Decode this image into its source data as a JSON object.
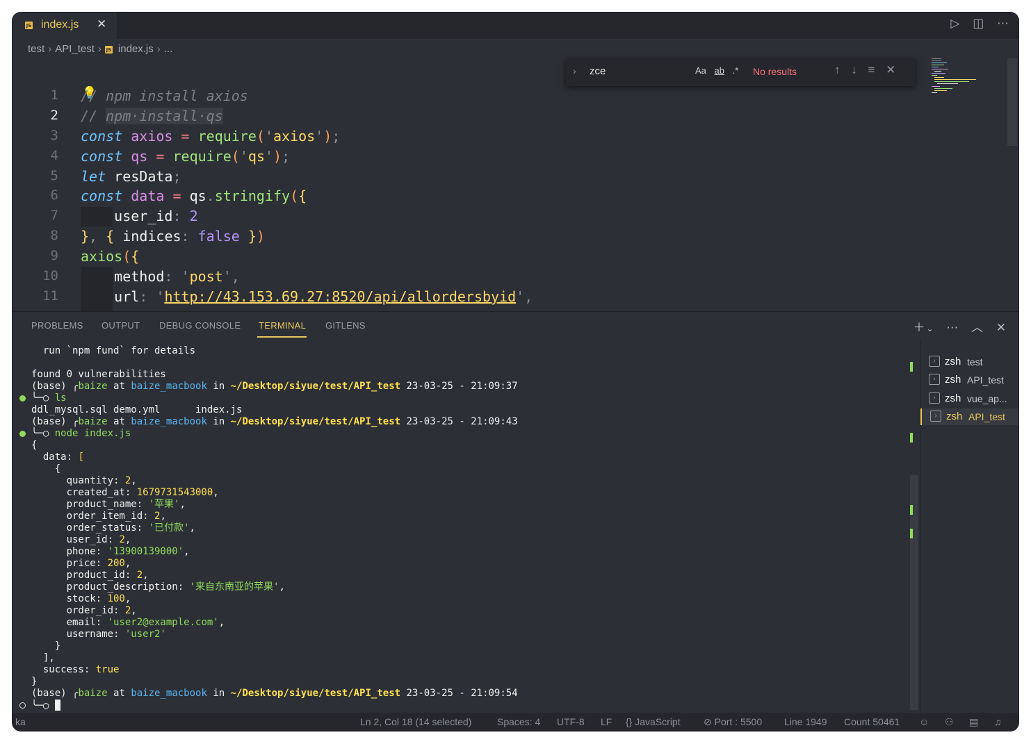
{
  "tab": {
    "filename": "index.js",
    "close": "✕"
  },
  "titlebar_icons": [
    "run-icon",
    "split-editor-icon",
    "more-icon"
  ],
  "breadcrumb": {
    "parts": [
      "test",
      "API_test",
      "index.js",
      "..."
    ]
  },
  "editor": {
    "line_numbers": [
      "1",
      "2",
      "3",
      "4",
      "5",
      "6",
      "7",
      "8",
      "9",
      "10",
      "11"
    ],
    "current_line": 2
  },
  "find": {
    "query": "zce",
    "options": [
      "Aa",
      "ab",
      ".*"
    ],
    "result": "No results"
  },
  "panel": {
    "tabs": [
      "PROBLEMS",
      "OUTPUT",
      "DEBUG CONSOLE",
      "TERMINAL",
      "GITLENS"
    ],
    "active_tab": "TERMINAL"
  },
  "terminal": {
    "lines": [
      "  run `npm fund` for details",
      "",
      "found 0 vulnerabilities",
      "(base) ╭baize at baize_macbook in ~/Desktop/siyue/test/API_test 23-03-25 - 21:09:37",
      "╰─○ ls",
      "ddl_mysql.sql demo.yml      index.js",
      "(base) ╭baize at baize_macbook in ~/Desktop/siyue/test/API_test 23-03-25 - 21:09:43",
      "╰─○ node index.js",
      "{",
      "  data: [",
      "    {",
      "      quantity: 2,",
      "      created_at: 1679731543000,",
      "      product_name: '苹果',",
      "      order_item_id: 2,",
      "      order_status: '已付款',",
      "      user_id: 2,",
      "      phone: '13900139000',",
      "      price: 200,",
      "      product_id: 2,",
      "      product_description: '来自东南亚的苹果',",
      "      stock: 100,",
      "      order_id: 2,",
      "      email: 'user2@example.com',",
      "      username: 'user2'",
      "    }",
      "  ],",
      "  success: true",
      "}",
      "(base) ╭baize at baize_macbook in ~/Desktop/siyue/test/API_test 23-03-25 - 21:09:54",
      "╰─○ "
    ],
    "sessions": [
      {
        "shell": "zsh",
        "name": "test"
      },
      {
        "shell": "zsh",
        "name": "API_test"
      },
      {
        "shell": "zsh",
        "name": "vue_ap..."
      },
      {
        "shell": "zsh",
        "name": "API_test"
      }
    ],
    "selected_session": 3
  },
  "status_bar": {
    "left": "ka",
    "position": "Ln 2, Col 18 (14 selected)",
    "spaces": "Spaces: 4",
    "encoding": "UTF-8",
    "eol": "LF",
    "language": "JavaScript",
    "port": "Port : 5500",
    "line_count": "Line 1949",
    "count": "Count 50461"
  },
  "colors": {
    "accent": "#e9c85a",
    "error": "#ff6f80",
    "prompt_green": "#8edc5a"
  }
}
